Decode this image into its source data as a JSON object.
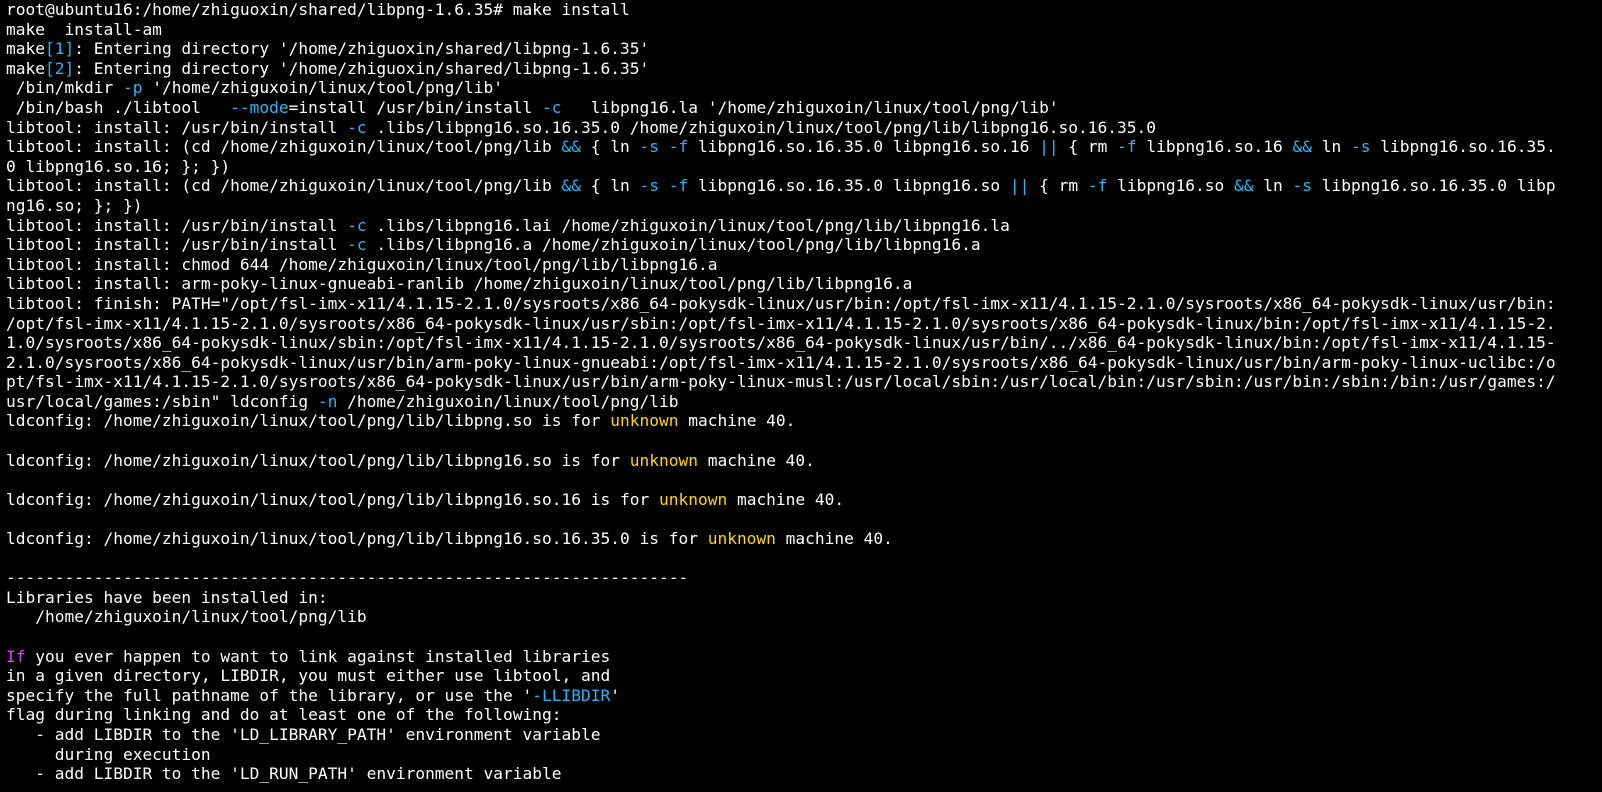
{
  "terminal": {
    "prompt": "root@ubuntu16:/home/zhiguoxin/shared/libpng-1.6.35#",
    "command": "make install",
    "colors": {
      "background": "#000000",
      "text": "#ffffff",
      "cyan": "#29b6f6",
      "yellow": "#ffd600",
      "magenta": "#e040fb"
    },
    "lines": [
      [
        {
          "t": "root@ubuntu16:/home/zhiguoxin/shared/libpng-1.6.35# make install"
        }
      ],
      [
        {
          "t": "make  install-am"
        }
      ],
      [
        {
          "t": "make"
        },
        {
          "t": "[1]",
          "c": "cyan"
        },
        {
          "t": ": Entering directory '/home/zhiguoxin/shared/libpng-1.6.35'"
        }
      ],
      [
        {
          "t": "make"
        },
        {
          "t": "[2]",
          "c": "cyan"
        },
        {
          "t": ": Entering directory '/home/zhiguoxin/shared/libpng-1.6.35'"
        }
      ],
      [
        {
          "t": " /bin/mkdir "
        },
        {
          "t": "-p",
          "c": "cyan"
        },
        {
          "t": " '/home/zhiguxoin/linux/tool/png/lib'"
        }
      ],
      [
        {
          "t": " /bin/bash ./libtool   "
        },
        {
          "t": "--mode",
          "c": "cyan"
        },
        {
          "t": "=install /usr/bin/install "
        },
        {
          "t": "-c",
          "c": "cyan"
        },
        {
          "t": "   libpng16.la '/home/zhiguxoin/linux/tool/png/lib'"
        }
      ],
      [
        {
          "t": "libtool: install: /usr/bin/install "
        },
        {
          "t": "-c",
          "c": "cyan"
        },
        {
          "t": " .libs/libpng16.so.16.35.0 /home/zhiguxoin/linux/tool/png/lib/libpng16.so.16.35.0"
        }
      ],
      [
        {
          "t": "libtool: install: (cd /home/zhiguxoin/linux/tool/png/lib "
        },
        {
          "t": "&&",
          "c": "cyan"
        },
        {
          "t": " { ln "
        },
        {
          "t": "-s",
          "c": "cyan"
        },
        {
          "t": " "
        },
        {
          "t": "-f",
          "c": "cyan"
        },
        {
          "t": " libpng16.so.16.35.0 libpng16.so.16 "
        },
        {
          "t": "||",
          "c": "cyan"
        },
        {
          "t": " { rm "
        },
        {
          "t": "-f",
          "c": "cyan"
        },
        {
          "t": " libpng16.so.16 "
        },
        {
          "t": "&&",
          "c": "cyan"
        },
        {
          "t": " ln "
        },
        {
          "t": "-s",
          "c": "cyan"
        },
        {
          "t": " libpng16.so.16.35."
        }
      ],
      [
        {
          "t": "0 libpng16.so.16; }; })"
        }
      ],
      [
        {
          "t": "libtool: install: (cd /home/zhiguxoin/linux/tool/png/lib "
        },
        {
          "t": "&&",
          "c": "cyan"
        },
        {
          "t": " { ln "
        },
        {
          "t": "-s",
          "c": "cyan"
        },
        {
          "t": " "
        },
        {
          "t": "-f",
          "c": "cyan"
        },
        {
          "t": " libpng16.so.16.35.0 libpng16.so "
        },
        {
          "t": "||",
          "c": "cyan"
        },
        {
          "t": " { rm "
        },
        {
          "t": "-f",
          "c": "cyan"
        },
        {
          "t": " libpng16.so "
        },
        {
          "t": "&&",
          "c": "cyan"
        },
        {
          "t": " ln "
        },
        {
          "t": "-s",
          "c": "cyan"
        },
        {
          "t": " libpng16.so.16.35.0 libp"
        }
      ],
      [
        {
          "t": "ng16.so; }; })"
        }
      ],
      [
        {
          "t": "libtool: install: /usr/bin/install "
        },
        {
          "t": "-c",
          "c": "cyan"
        },
        {
          "t": " .libs/libpng16.lai /home/zhiguxoin/linux/tool/png/lib/libpng16.la"
        }
      ],
      [
        {
          "t": "libtool: install: /usr/bin/install "
        },
        {
          "t": "-c",
          "c": "cyan"
        },
        {
          "t": " .libs/libpng16.a /home/zhiguxoin/linux/tool/png/lib/libpng16.a"
        }
      ],
      [
        {
          "t": "libtool: install: chmod 644 /home/zhiguxoin/linux/tool/png/lib/libpng16.a"
        }
      ],
      [
        {
          "t": "libtool: install: arm-poky-linux-gnueabi-ranlib /home/zhiguxoin/linux/tool/png/lib/libpng16.a"
        }
      ],
      [
        {
          "t": "libtool: finish: PATH=\"/opt/fsl-imx-x11/4.1.15-2.1.0/sysroots/x86_64-pokysdk-linux/usr/bin:/opt/fsl-imx-x11/4.1.15-2.1.0/sysroots/x86_64-pokysdk-linux/usr/bin:"
        }
      ],
      [
        {
          "t": "/opt/fsl-imx-x11/4.1.15-2.1.0/sysroots/x86_64-pokysdk-linux/usr/sbin:/opt/fsl-imx-x11/4.1.15-2.1.0/sysroots/x86_64-pokysdk-linux/bin:/opt/fsl-imx-x11/4.1.15-2."
        }
      ],
      [
        {
          "t": "1.0/sysroots/x86_64-pokysdk-linux/sbin:/opt/fsl-imx-x11/4.1.15-2.1.0/sysroots/x86_64-pokysdk-linux/usr/bin/../x86_64-pokysdk-linux/bin:/opt/fsl-imx-x11/4.1.15-"
        }
      ],
      [
        {
          "t": "2.1.0/sysroots/x86_64-pokysdk-linux/usr/bin/arm-poky-linux-gnueabi:/opt/fsl-imx-x11/4.1.15-2.1.0/sysroots/x86_64-pokysdk-linux/usr/bin/arm-poky-linux-uclibc:/o"
        }
      ],
      [
        {
          "t": "pt/fsl-imx-x11/4.1.15-2.1.0/sysroots/x86_64-pokysdk-linux/usr/bin/arm-poky-linux-musl:/usr/local/sbin:/usr/local/bin:/usr/sbin:/usr/bin:/sbin:/bin:/usr/games:/"
        }
      ],
      [
        {
          "t": "usr/local/games:/sbin\" ldconfig "
        },
        {
          "t": "-n",
          "c": "cyan"
        },
        {
          "t": " /home/zhiguxoin/linux/tool/png/lib"
        }
      ],
      [
        {
          "t": "ldconfig: /home/zhiguxoin/linux/tool/png/lib/libpng.so is for "
        },
        {
          "t": "unknown",
          "c": "yellow"
        },
        {
          "t": " machine 40."
        }
      ],
      [
        {
          "t": ""
        }
      ],
      [
        {
          "t": "ldconfig: /home/zhiguxoin/linux/tool/png/lib/libpng16.so is for "
        },
        {
          "t": "unknown",
          "c": "yellow"
        },
        {
          "t": " machine 40."
        }
      ],
      [
        {
          "t": ""
        }
      ],
      [
        {
          "t": "ldconfig: /home/zhiguxoin/linux/tool/png/lib/libpng16.so.16 is for "
        },
        {
          "t": "unknown",
          "c": "yellow"
        },
        {
          "t": " machine 40."
        }
      ],
      [
        {
          "t": ""
        }
      ],
      [
        {
          "t": "ldconfig: /home/zhiguxoin/linux/tool/png/lib/libpng16.so.16.35.0 is for "
        },
        {
          "t": "unknown",
          "c": "yellow"
        },
        {
          "t": " machine 40."
        }
      ],
      [
        {
          "t": ""
        }
      ],
      [
        {
          "t": "----------------------------------------------------------------------"
        }
      ],
      [
        {
          "t": "Libraries have been installed in:"
        }
      ],
      [
        {
          "t": "   /home/zhiguxoin/linux/tool/png/lib"
        }
      ],
      [
        {
          "t": ""
        }
      ],
      [
        {
          "t": "If",
          "c": "magenta"
        },
        {
          "t": " you ever happen to want to link against installed libraries"
        }
      ],
      [
        {
          "t": "in a given directory, LIBDIR, you must either use libtool, and"
        }
      ],
      [
        {
          "t": "specify the full pathname of the library, or use the '"
        },
        {
          "t": "-LLIBDIR",
          "c": "cyan"
        },
        {
          "t": "'"
        }
      ],
      [
        {
          "t": "flag during linking and do at least one of the following:"
        }
      ],
      [
        {
          "t": "   - add LIBDIR to the 'LD_LIBRARY_PATH' environment variable"
        }
      ],
      [
        {
          "t": "     during execution"
        }
      ],
      [
        {
          "t": "   - add LIBDIR to the 'LD_RUN_PATH' environment variable"
        }
      ]
    ]
  }
}
